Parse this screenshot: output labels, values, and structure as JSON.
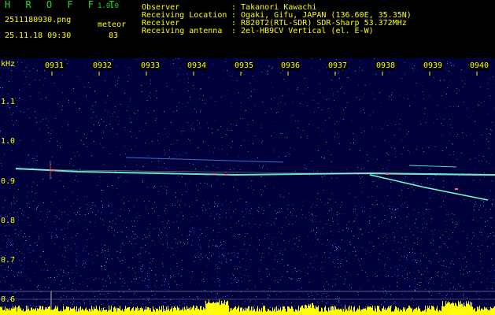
{
  "app": {
    "title": "H R O F F T",
    "version": "1.0.0"
  },
  "file": {
    "name": "2511180930.png",
    "datetime": "25.11.18 09:30"
  },
  "meteor": {
    "label": "meteor",
    "count": "83"
  },
  "meta": [
    {
      "key": "Observer",
      "value": ": Takanori Kawachi"
    },
    {
      "key": "Receiving Location",
      "value": ": Ogaki, Gifu, JAPAN (136.60E, 35.35N)"
    },
    {
      "key": "Receiver",
      "value": ": R820T2(RTL-SDR) SDR-Sharp 53.372MHz"
    },
    {
      "key": "Receiving antenna",
      "value": ": 2el-HB9CV Vertical (el. E-W)"
    }
  ],
  "axis": {
    "unit": "kHz",
    "time_ticks": [
      "0931",
      "0932",
      "0933",
      "0934",
      "0935",
      "0936",
      "0937",
      "0938",
      "0939",
      "0940"
    ],
    "freq_ticks": [
      "1.1",
      "1.0",
      "0.9",
      "0.8",
      "0.7",
      "0.6"
    ]
  },
  "colors": {
    "background": "#00003a",
    "text": "#ffff00",
    "title": "#22dd22",
    "signal": "#66ffcc",
    "bottom_noise": "#ffff00"
  }
}
